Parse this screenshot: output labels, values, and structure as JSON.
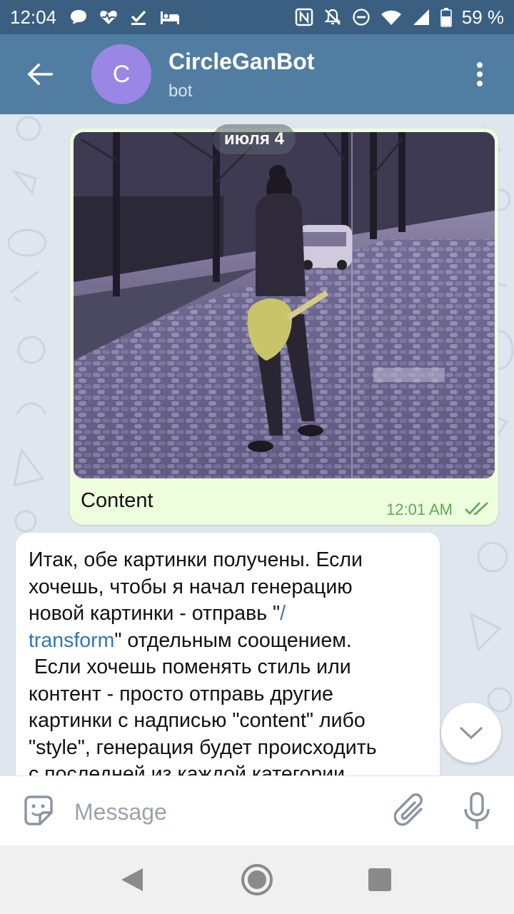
{
  "status_bar": {
    "time": "12:04",
    "battery": "59 %"
  },
  "header": {
    "avatar_letter": "C",
    "title": "CircleGanBot",
    "subtitle": "bot"
  },
  "messages": {
    "outgoing": {
      "date_label": "июля 4",
      "caption": "Content",
      "time": "12:01 AM"
    },
    "incoming": {
      "line1": "Итак, обе картинки получены. Если",
      "line2": "хочешь, чтобы я начал генерацию",
      "line3_prefix": "новой картинки - отправь \"",
      "link_part1": "/",
      "link_part2": "transform",
      "line4_suffix": "\" отдельным соощением.",
      "line5": " Если хочешь поменять стиль или",
      "line6": "контент - просто отправь другие",
      "line7": "картинки с надписью \"content\" либо",
      "line8": "\"style\", генерация будет происходить",
      "line9": "с последней из каждой категории."
    }
  },
  "composer": {
    "placeholder": "Message"
  },
  "colors": {
    "header": "#517da2",
    "status_bar": "#3a5f80",
    "outgoing_bubble": "#eeffde",
    "incoming_bubble": "#ffffff",
    "link": "#2f78b5",
    "avatar": "#9a86e4"
  },
  "icons": [
    "chat-icon",
    "heart-pulse-icon",
    "checkmark-icon",
    "bed-icon",
    "nfc-icon",
    "mute-bell-icon",
    "dnd-icon",
    "wifi-icon",
    "signal-icon",
    "battery-icon",
    "back-arrow-icon",
    "more-vert-icon",
    "chevron-down-icon",
    "sticker-icon",
    "attach-icon",
    "mic-icon",
    "nav-back-icon",
    "nav-home-icon",
    "nav-recent-icon"
  ]
}
